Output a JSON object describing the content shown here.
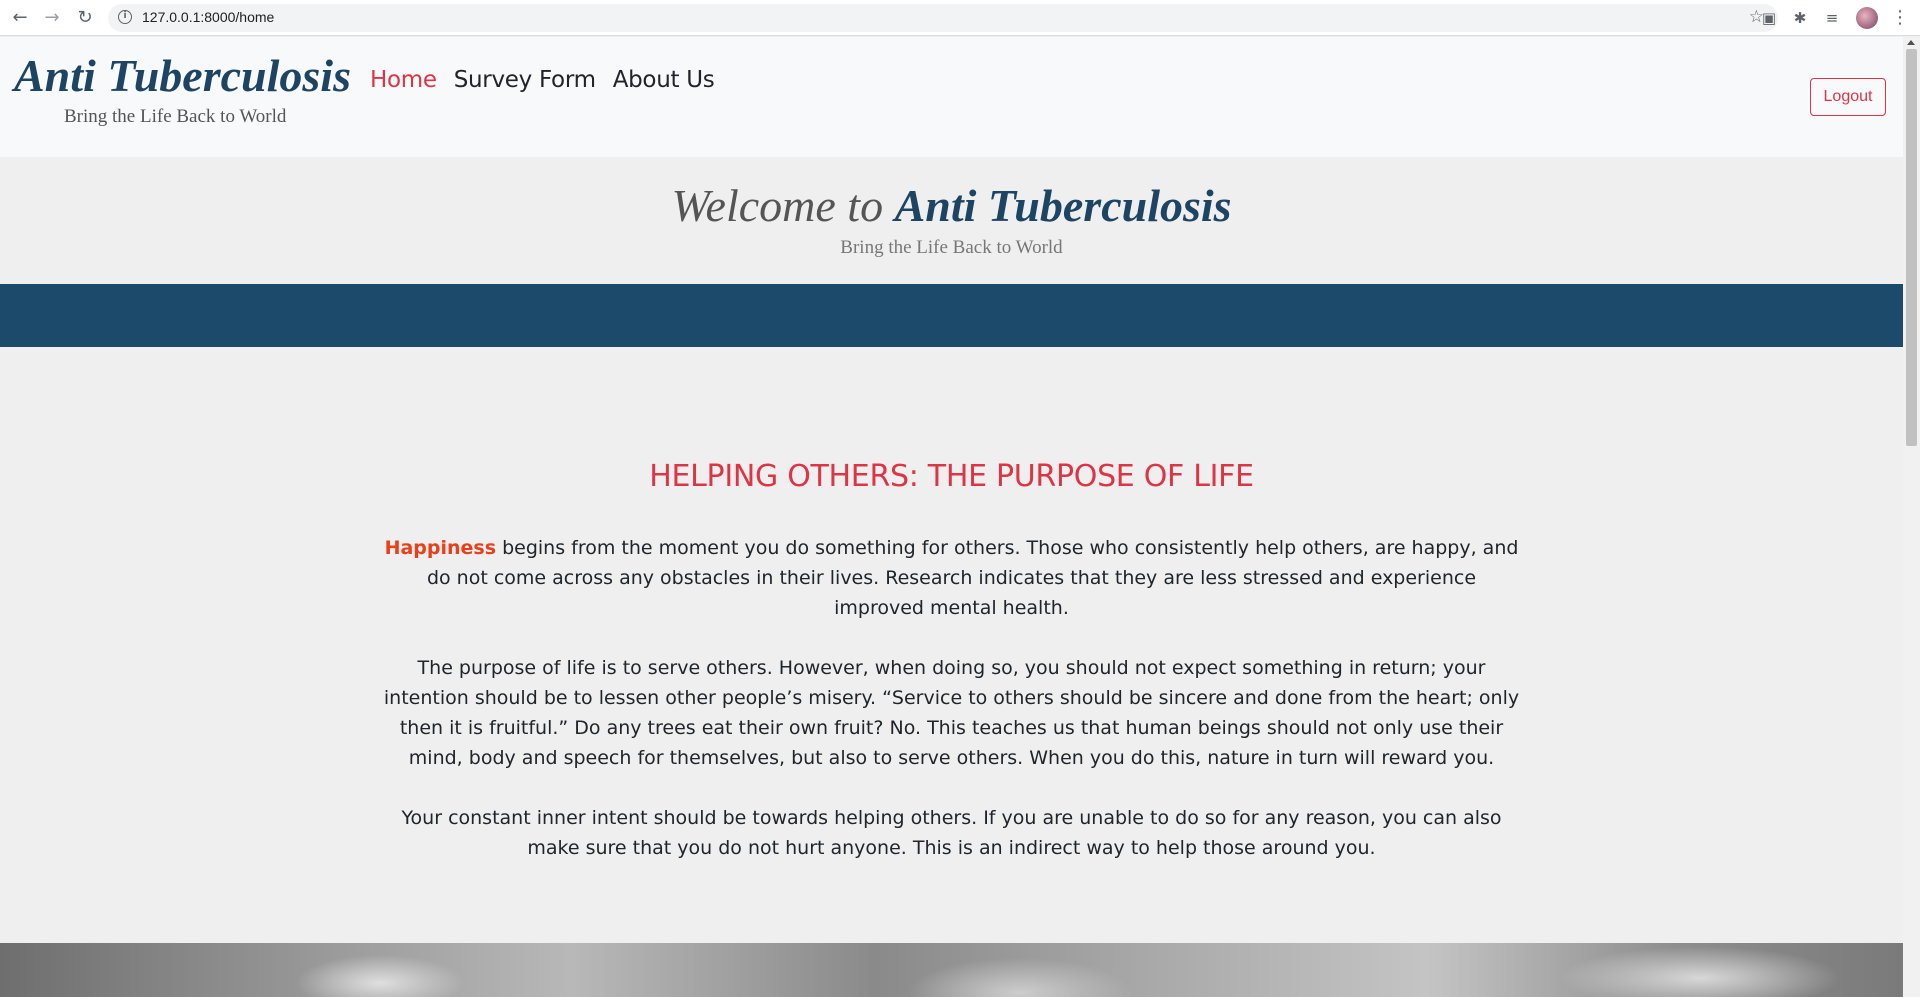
{
  "browser": {
    "url": "127.0.0.1:8000/home"
  },
  "navbar": {
    "brand": "Anti Tuberculosis",
    "tagline": "Bring the Life Back to World",
    "links": [
      {
        "label": "Home"
      },
      {
        "label": "Survey Form"
      },
      {
        "label": "About Us"
      }
    ],
    "logout_label": "Logout"
  },
  "welcome": {
    "prefix": "Welcome to",
    "brand": "Anti Tuberculosis",
    "tagline": "Bring the Life Back to World"
  },
  "section": {
    "title": "HELPING OTHERS: THE PURPOSE OF LIFE",
    "p1_highlight": "Happiness",
    "p1_rest": " begins from the moment you do something for others. Those who consistently help others, are happy, and do not come across any obstacles in their lives. Research indicates that they are less stressed and experience improved mental health.",
    "p2": "The purpose of life is to serve others. However, when doing so, you should not expect something in return; your intention should be to lessen other people’s misery. “Service to others should be sincere and done from the heart; only then it is fruitful.” Do any trees eat their own fruit? No. This teaches us that human beings should not only use their mind, body and speech for themselves, but also to serve others. When you do this, nature in turn will reward you.",
    "p3": "Your constant inner intent should be towards helping others. If you are unable to do so for any reason, you can also make sure that you do not hurt anyone. This is an indirect way to help those around you."
  },
  "colors": {
    "brand_blue": "#1d4463",
    "band_blue": "#1b4a6b",
    "accent_red": "#dc3545",
    "highlight_orange": "#e8401a"
  }
}
